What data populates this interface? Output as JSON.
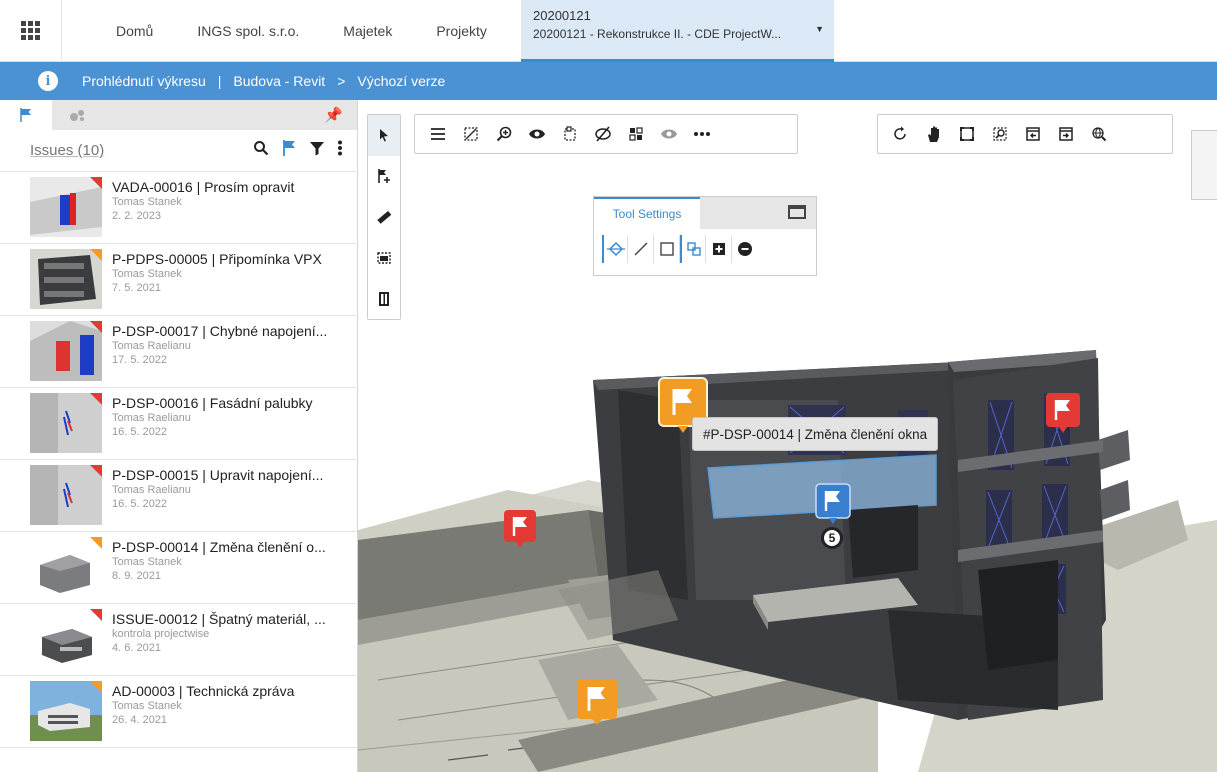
{
  "topnav": {
    "items": [
      {
        "label": "Domů"
      },
      {
        "label": "INGS spol. s.r.o."
      },
      {
        "label": "Majetek"
      },
      {
        "label": "Projekty"
      }
    ],
    "project": {
      "code": "20200121",
      "name": "20200121 - Rekonstrukce II. - CDE ProjectW..."
    }
  },
  "breadcrumb": {
    "page": "Prohlédnutí výkresu",
    "separator": "|",
    "model": "Budova - Revit",
    "arrow": ">",
    "version": "Výchozí verze"
  },
  "issues": {
    "title": "Issues (10)",
    "items": [
      {
        "title": "VADA-00016 | Prosím opravit",
        "author": "Tomas Stanek",
        "date": "2. 2. 2023",
        "flag": "red",
        "thumb": "facade-red"
      },
      {
        "title": "P-PDPS-00005 | Připomínka VPX",
        "author": "Tomas Stanek",
        "date": "7. 5. 2021",
        "flag": "orange",
        "thumb": "building-dark"
      },
      {
        "title": "P-DSP-00017 | Chybné napojení...",
        "author": "Tomas Raelianu",
        "date": "17. 5. 2022",
        "flag": "red",
        "thumb": "detail-red-blue"
      },
      {
        "title": "P-DSP-00016 | Fasádní palubky",
        "author": "Tomas Raelianu",
        "date": "16. 5. 2022",
        "flag": "red",
        "thumb": "wall-grey"
      },
      {
        "title": "P-DSP-00015 | Upravit napojení...",
        "author": "Tomas Raelianu",
        "date": "16. 5. 2022",
        "flag": "red",
        "thumb": "wall-grey"
      },
      {
        "title": "P-DSP-00014 | Změna členění o...",
        "author": "Tomas Stanek",
        "date": "8. 9. 2021",
        "flag": "orange",
        "thumb": "building-white"
      },
      {
        "title": "ISSUE-00012 | Špatný materiál, ...",
        "author": "kontrola projectwise",
        "date": "4. 6. 2021",
        "flag": "red",
        "thumb": "building-small"
      },
      {
        "title": "AD-00003 | Technická zpráva",
        "author": "Tomas Stanek",
        "date": "26. 4. 2021",
        "flag": "orange",
        "thumb": "render-sky"
      }
    ]
  },
  "toolsettings": {
    "title": "Tool Settings"
  },
  "viewport": {
    "tooltip": "#P-DSP-00014 | Změna členění okna",
    "badge": "5"
  },
  "colors": {
    "accent": "#4a92d3",
    "flag_red": "#e53935",
    "flag_orange": "#f39c24",
    "flag_blue": "#3a7fcf"
  },
  "icons": {
    "apps": "apps-grid-icon",
    "info": "info-icon",
    "flag": "flag-icon",
    "search": "search-icon",
    "filter": "filter-icon",
    "more": "more-vertical-icon",
    "pin": "pin-icon"
  }
}
